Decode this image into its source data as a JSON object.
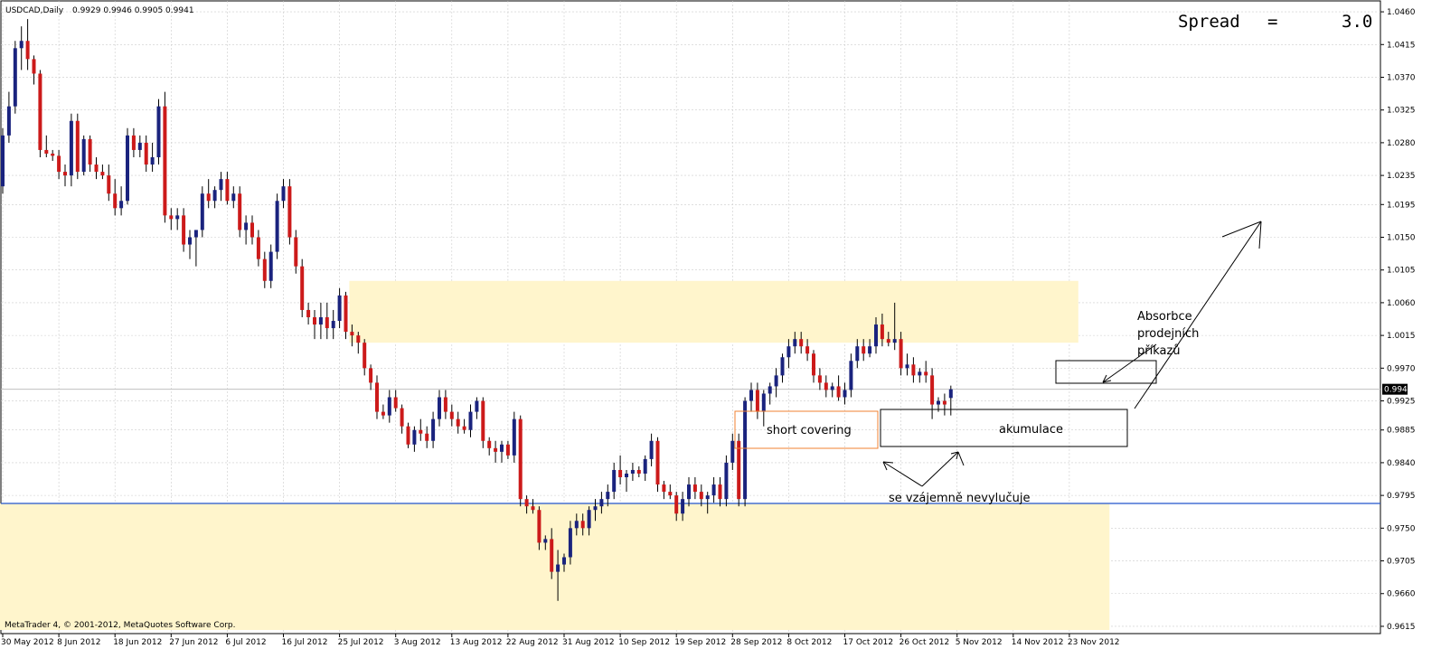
{
  "header": {
    "ticker": "USDCAD,Daily",
    "ohlc": "0.9929 0.9946 0.9905 0.9941"
  },
  "spread": {
    "label": "Spread",
    "eq": "=",
    "value": "3.0"
  },
  "footer": {
    "copyright": "MetaTrader 4, © 2001-2012, MetaQuotes Software Corp."
  },
  "colors": {
    "bull": "#1a237e",
    "bear": "#cc1a1a",
    "zone": "#fff5cc",
    "support_line": "#2255cc",
    "grid": "#cccccc",
    "short_covering_box": "#f08030"
  },
  "chart_data": {
    "type": "candlestick",
    "title": "",
    "y_range": [
      0.9605,
      1.0475
    ],
    "y_ticks": [
      "1.0460",
      "1.0415",
      "1.0370",
      "1.0325",
      "1.0280",
      "1.0235",
      "1.0195",
      "1.0150",
      "1.0105",
      "1.0060",
      "1.0015",
      "0.9970",
      "0.9925",
      "0.9885",
      "0.9840",
      "0.9795",
      "0.9750",
      "0.9705",
      "0.9660",
      "0.9615"
    ],
    "x_ticks": [
      "30 May 2012",
      "8 Jun 2012",
      "18 Jun 2012",
      "27 Jun 2012",
      "6 Jul 2012",
      "16 Jul 2012",
      "25 Jul 2012",
      "3 Aug 2012",
      "13 Aug 2012",
      "22 Aug 2012",
      "31 Aug 2012",
      "10 Sep 2012",
      "19 Sep 2012",
      "28 Sep 2012",
      "8 Oct 2012",
      "17 Oct 2012",
      "26 Oct 2012",
      "5 Nov 2012",
      "14 Nov 2012",
      "23 Nov 2012"
    ],
    "current_price": "0.9941",
    "support_level": 0.9784,
    "zones": [
      {
        "from_index": 56,
        "to_index": 172,
        "price_low": 1.0005,
        "price_high": 1.009
      },
      {
        "from_index": 0,
        "to_index": 177,
        "price_low": 0.961,
        "price_high": 0.9784
      }
    ],
    "annotations": [
      {
        "text": "short covering",
        "box": true
      },
      {
        "text": "akumulace",
        "box": true
      },
      {
        "text": "se vzájemně nevylučuje",
        "box": false
      },
      {
        "text": "Absorbce",
        "box": false
      },
      {
        "text": "prodejních",
        "box": false
      },
      {
        "text": "příkazů",
        "box": false
      }
    ],
    "candles": [
      [
        1.022,
        1.03,
        1.021,
        1.029
      ],
      [
        1.029,
        1.035,
        1.028,
        1.033
      ],
      [
        1.033,
        1.042,
        1.032,
        1.041
      ],
      [
        1.041,
        1.044,
        1.038,
        1.042
      ],
      [
        1.042,
        1.045,
        1.038,
        1.0395
      ],
      [
        1.0395,
        1.04,
        1.036,
        1.0375
      ],
      [
        1.0375,
        1.038,
        1.026,
        1.027
      ],
      [
        1.027,
        1.029,
        1.026,
        1.0265
      ],
      [
        1.0265,
        1.027,
        1.0255,
        1.0262
      ],
      [
        1.0262,
        1.027,
        1.023,
        1.024
      ],
      [
        1.024,
        1.025,
        1.022,
        1.0235
      ],
      [
        1.0235,
        1.032,
        1.022,
        1.031
      ],
      [
        1.031,
        1.032,
        1.023,
        1.024
      ],
      [
        1.024,
        1.029,
        1.0235,
        1.0285
      ],
      [
        1.0285,
        1.029,
        1.024,
        1.025
      ],
      [
        1.025,
        1.026,
        1.023,
        1.024
      ],
      [
        1.024,
        1.025,
        1.023,
        1.0235
      ],
      [
        1.0235,
        1.025,
        1.02,
        1.021
      ],
      [
        1.021,
        1.023,
        1.018,
        1.019
      ],
      [
        1.019,
        1.022,
        1.018,
        1.02
      ],
      [
        1.02,
        1.03,
        1.0195,
        1.029
      ],
      [
        1.029,
        1.03,
        1.026,
        1.027
      ],
      [
        1.027,
        1.029,
        1.026,
        1.028
      ],
      [
        1.028,
        1.029,
        1.024,
        1.025
      ],
      [
        1.025,
        1.028,
        1.024,
        1.026
      ],
      [
        1.026,
        1.034,
        1.025,
        1.033
      ],
      [
        1.033,
        1.035,
        1.017,
        1.018
      ],
      [
        1.018,
        1.019,
        1.016,
        1.0175
      ],
      [
        1.0175,
        1.019,
        1.016,
        1.018
      ],
      [
        1.018,
        1.019,
        1.013,
        1.014
      ],
      [
        1.014,
        1.016,
        1.012,
        1.015
      ],
      [
        1.015,
        1.016,
        1.011,
        1.016
      ],
      [
        1.016,
        1.022,
        1.015,
        1.021
      ],
      [
        1.021,
        1.023,
        1.019,
        1.02
      ],
      [
        1.02,
        1.022,
        1.019,
        1.0215
      ],
      [
        1.0215,
        1.024,
        1.02,
        1.023
      ],
      [
        1.023,
        1.024,
        1.0195,
        1.02
      ],
      [
        1.02,
        1.022,
        1.019,
        1.021
      ],
      [
        1.021,
        1.022,
        1.015,
        1.016
      ],
      [
        1.016,
        1.018,
        1.014,
        1.017
      ],
      [
        1.017,
        1.018,
        1.014,
        1.015
      ],
      [
        1.015,
        1.016,
        1.011,
        1.012
      ],
      [
        1.012,
        1.013,
        1.008,
        1.009
      ],
      [
        1.009,
        1.014,
        1.008,
        1.013
      ],
      [
        1.013,
        1.021,
        1.012,
        1.02
      ],
      [
        1.02,
        1.023,
        1.019,
        1.022
      ],
      [
        1.022,
        1.023,
        1.014,
        1.015
      ],
      [
        1.015,
        1.016,
        1.01,
        1.011
      ],
      [
        1.011,
        1.012,
        1.004,
        1.005
      ],
      [
        1.005,
        1.006,
        1.003,
        1.004
      ],
      [
        1.004,
        1.005,
        1.001,
        1.003
      ],
      [
        1.003,
        1.006,
        1.001,
        1.004
      ],
      [
        1.004,
        1.006,
        1.001,
        1.0025
      ],
      [
        1.0025,
        1.005,
        1.001,
        1.0035
      ],
      [
        1.0035,
        1.008,
        1.0025,
        1.007
      ],
      [
        1.007,
        1.0075,
        1.001,
        1.002
      ],
      [
        1.002,
        1.003,
        1.0,
        1.0015
      ],
      [
        1.0015,
        1.002,
        0.999,
        1.0005
      ],
      [
        1.0005,
        1.001,
        0.996,
        0.997
      ],
      [
        0.997,
        0.9975,
        0.994,
        0.995
      ],
      [
        0.995,
        0.996,
        0.99,
        0.991
      ],
      [
        0.991,
        0.992,
        0.99,
        0.9905
      ],
      [
        0.9905,
        0.994,
        0.9895,
        0.993
      ],
      [
        0.993,
        0.994,
        0.991,
        0.9915
      ],
      [
        0.9915,
        0.992,
        0.988,
        0.989
      ],
      [
        0.989,
        0.9895,
        0.986,
        0.9865
      ],
      [
        0.9865,
        0.989,
        0.9855,
        0.9885
      ],
      [
        0.9885,
        0.99,
        0.987,
        0.988
      ],
      [
        0.988,
        0.989,
        0.986,
        0.987
      ],
      [
        0.987,
        0.991,
        0.986,
        0.99
      ],
      [
        0.99,
        0.994,
        0.989,
        0.993
      ],
      [
        0.993,
        0.994,
        0.99,
        0.991
      ],
      [
        0.991,
        0.992,
        0.989,
        0.99
      ],
      [
        0.99,
        0.991,
        0.988,
        0.989
      ],
      [
        0.989,
        0.99,
        0.988,
        0.9885
      ],
      [
        0.9885,
        0.992,
        0.9875,
        0.991
      ],
      [
        0.991,
        0.993,
        0.99,
        0.9925
      ],
      [
        0.9925,
        0.993,
        0.986,
        0.987
      ],
      [
        0.987,
        0.9875,
        0.985,
        0.986
      ],
      [
        0.986,
        0.987,
        0.984,
        0.9855
      ],
      [
        0.9855,
        0.987,
        0.984,
        0.9865
      ],
      [
        0.9865,
        0.987,
        0.9845,
        0.985
      ],
      [
        0.985,
        0.991,
        0.984,
        0.99
      ],
      [
        0.99,
        0.9905,
        0.978,
        0.979
      ],
      [
        0.979,
        0.9795,
        0.977,
        0.978
      ],
      [
        0.978,
        0.979,
        0.977,
        0.9775
      ],
      [
        0.9775,
        0.978,
        0.972,
        0.973
      ],
      [
        0.973,
        0.974,
        0.972,
        0.9735
      ],
      [
        0.9735,
        0.975,
        0.968,
        0.969
      ],
      [
        0.969,
        0.972,
        0.965,
        0.97
      ],
      [
        0.97,
        0.9715,
        0.969,
        0.971
      ],
      [
        0.971,
        0.976,
        0.97,
        0.975
      ],
      [
        0.975,
        0.977,
        0.974,
        0.976
      ],
      [
        0.976,
        0.977,
        0.974,
        0.975
      ],
      [
        0.975,
        0.978,
        0.974,
        0.9775
      ],
      [
        0.9775,
        0.979,
        0.976,
        0.978
      ],
      [
        0.978,
        0.98,
        0.977,
        0.979
      ],
      [
        0.979,
        0.981,
        0.978,
        0.98
      ],
      [
        0.98,
        0.984,
        0.979,
        0.983
      ],
      [
        0.983,
        0.985,
        0.981,
        0.982
      ],
      [
        0.982,
        0.983,
        0.98,
        0.9825
      ],
      [
        0.9825,
        0.984,
        0.9815,
        0.983
      ],
      [
        0.983,
        0.9835,
        0.982,
        0.9825
      ],
      [
        0.9825,
        0.985,
        0.9815,
        0.9845
      ],
      [
        0.9845,
        0.988,
        0.9835,
        0.987
      ],
      [
        0.987,
        0.9875,
        0.98,
        0.981
      ],
      [
        0.981,
        0.9815,
        0.979,
        0.98
      ],
      [
        0.98,
        0.981,
        0.979,
        0.9795
      ],
      [
        0.9795,
        0.98,
        0.976,
        0.977
      ],
      [
        0.977,
        0.98,
        0.976,
        0.979
      ],
      [
        0.979,
        0.982,
        0.978,
        0.981
      ],
      [
        0.981,
        0.982,
        0.979,
        0.98
      ],
      [
        0.98,
        0.981,
        0.978,
        0.979
      ],
      [
        0.979,
        0.98,
        0.977,
        0.9795
      ],
      [
        0.9795,
        0.982,
        0.9785,
        0.981
      ],
      [
        0.981,
        0.982,
        0.978,
        0.979
      ],
      [
        0.979,
        0.985,
        0.978,
        0.984
      ],
      [
        0.984,
        0.988,
        0.983,
        0.987
      ],
      [
        0.987,
        0.988,
        0.978,
        0.979
      ],
      [
        0.979,
        0.993,
        0.978,
        0.9925
      ],
      [
        0.9925,
        0.995,
        0.991,
        0.994
      ],
      [
        0.994,
        0.995,
        0.99,
        0.991
      ],
      [
        0.991,
        0.994,
        0.989,
        0.9935
      ],
      [
        0.9935,
        0.995,
        0.992,
        0.9945
      ],
      [
        0.9945,
        0.997,
        0.993,
        0.996
      ],
      [
        0.996,
        0.999,
        0.995,
        0.9985
      ],
      [
        0.9985,
        1.001,
        0.997,
        1.0
      ],
      [
        1.0,
        1.002,
        0.999,
        1.001
      ],
      [
        1.001,
        1.002,
        0.999,
        1.0
      ],
      [
        1.0,
        1.001,
        0.998,
        0.999
      ],
      [
        0.999,
        0.9995,
        0.995,
        0.996
      ],
      [
        0.996,
        0.997,
        0.994,
        0.995
      ],
      [
        0.995,
        0.996,
        0.993,
        0.994
      ],
      [
        0.994,
        0.995,
        0.993,
        0.9945
      ],
      [
        0.9945,
        0.996,
        0.9925,
        0.993
      ],
      [
        0.993,
        0.995,
        0.992,
        0.994
      ],
      [
        0.994,
        0.999,
        0.993,
        0.998
      ],
      [
        0.998,
        1.001,
        0.997,
        1.0
      ],
      [
        1.0,
        1.001,
        0.998,
        0.999
      ],
      [
        0.999,
        1.001,
        0.9985,
        1.0
      ],
      [
        1.0,
        1.004,
        0.999,
        1.003
      ],
      [
        1.003,
        1.0045,
        1.0,
        1.001
      ],
      [
        1.001,
        1.002,
        1.0,
        1.0005
      ],
      [
        1.0005,
        1.006,
        0.9995,
        1.001
      ],
      [
        1.001,
        1.002,
        0.996,
        0.997
      ],
      [
        0.997,
        0.999,
        0.996,
        0.9975
      ],
      [
        0.9975,
        0.9985,
        0.995,
        0.996
      ],
      [
        0.996,
        0.997,
        0.995,
        0.9965
      ],
      [
        0.9965,
        0.998,
        0.995,
        0.996
      ],
      [
        0.996,
        0.997,
        0.99,
        0.992
      ],
      [
        0.992,
        0.993,
        0.991,
        0.9925
      ],
      [
        0.9925,
        0.9935,
        0.9905,
        0.992
      ],
      [
        0.9929,
        0.9946,
        0.9905,
        0.9941
      ]
    ]
  }
}
